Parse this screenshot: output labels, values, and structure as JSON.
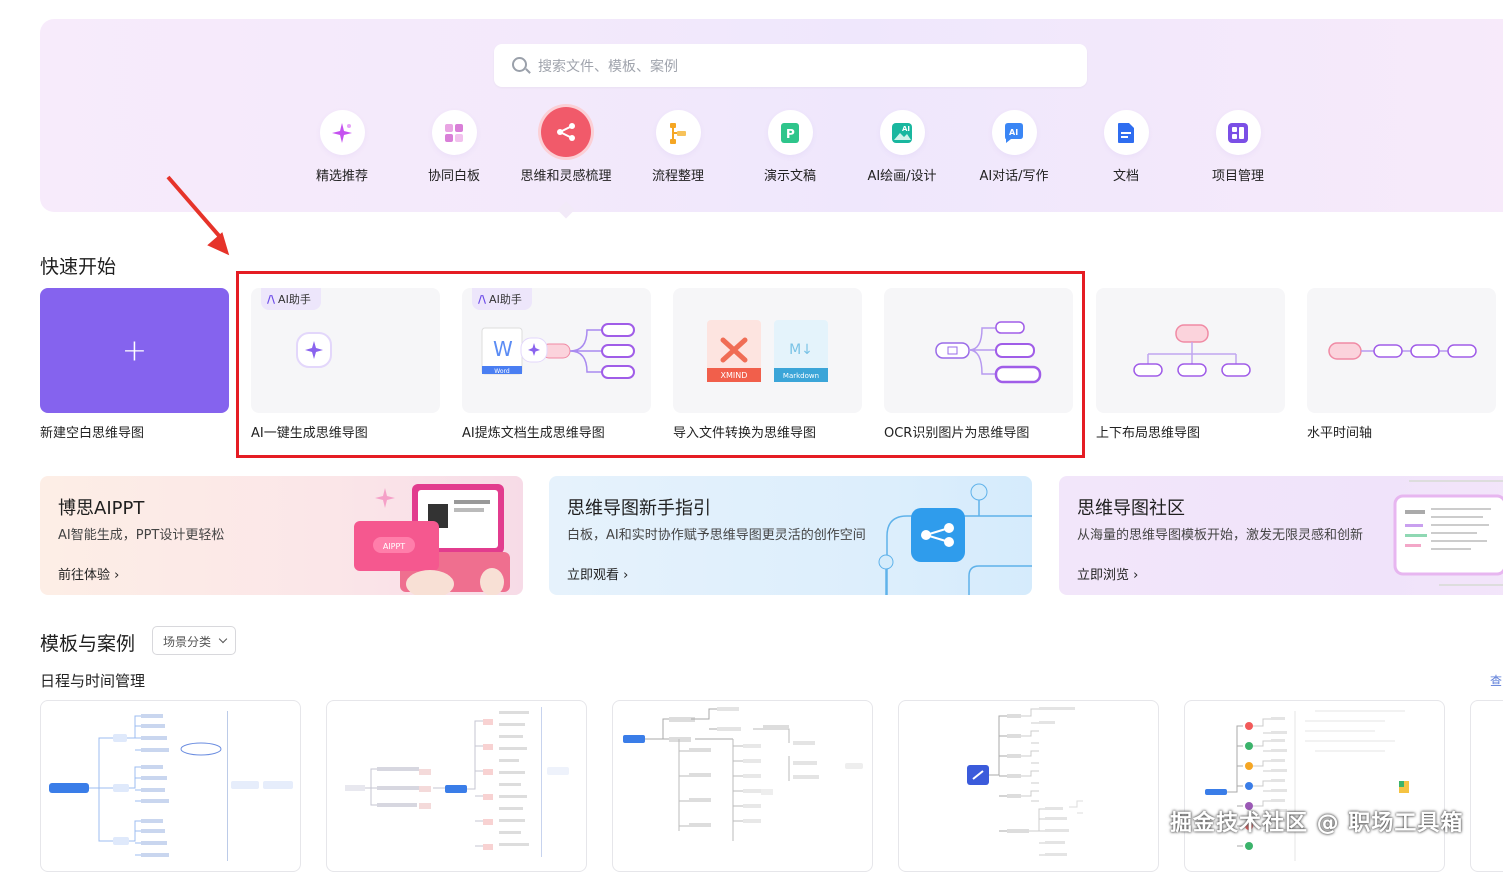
{
  "search": {
    "placeholder": "搜索文件、模板、案例"
  },
  "categories": [
    {
      "label": "精选推荐",
      "icon": "sparkle-icon"
    },
    {
      "label": "协同白板",
      "icon": "whiteboard-icon"
    },
    {
      "label": "思维和灵感梳理",
      "icon": "mindmap-icon",
      "selected": true
    },
    {
      "label": "流程整理",
      "icon": "flowchart-icon"
    },
    {
      "label": "演示文稿",
      "icon": "presentation-icon"
    },
    {
      "label": "AI绘画/设计",
      "icon": "ai-image-icon"
    },
    {
      "label": "AI对话/写作",
      "icon": "ai-chat-icon"
    },
    {
      "label": "文档",
      "icon": "document-icon"
    },
    {
      "label": "项目管理",
      "icon": "project-icon"
    }
  ],
  "quick_start": {
    "title": "快速开始",
    "items": [
      {
        "label": "新建空白思维导图"
      },
      {
        "label": "AI一键生成思维导图",
        "badge": "AI助手"
      },
      {
        "label": "AI提炼文档生成思维导图",
        "badge": "AI助手",
        "file_label": "Word"
      },
      {
        "label": "导入文件转换为思维导图",
        "files": [
          "XMIND",
          "Markdown"
        ]
      },
      {
        "label": "OCR识别图片为思维导图"
      },
      {
        "label": "上下布局思维导图"
      },
      {
        "label": "水平时间轴"
      }
    ]
  },
  "banners": [
    {
      "title": "博思AIPPT",
      "subtitle": "AI智能生成，PPT设计更轻松",
      "link": "前往体验",
      "art_label": "AIPPT"
    },
    {
      "title": "思维导图新手指引",
      "subtitle": "白板，AI和实时协作赋予思维导图更灵活的创作空间",
      "link": "立即观看"
    },
    {
      "title": "思维导图社区",
      "subtitle": "从海量的思维导图模板开始，激发无限灵感和创新",
      "link": "立即浏览"
    }
  ],
  "templates": {
    "title": "模板与案例",
    "filter": "场景分类",
    "group_title": "日程与时间管理",
    "more": "查"
  },
  "watermark": "掘金技术社区 @ 职场工具箱",
  "colors": {
    "accent_purple": "#8563ee",
    "selected_red": "#f15a6a",
    "highlight_red": "#e51c23"
  }
}
